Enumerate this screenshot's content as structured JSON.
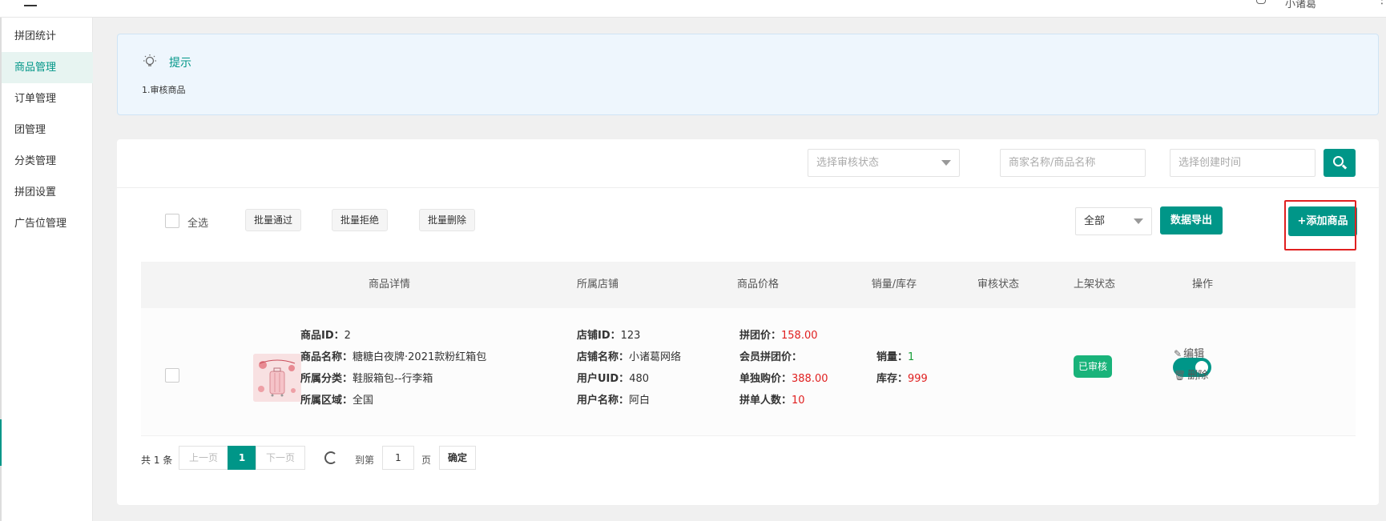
{
  "header": {
    "user_name": "小诸葛"
  },
  "sidebar": {
    "items": [
      {
        "label": "拼团统计"
      },
      {
        "label": "商品管理"
      },
      {
        "label": "订单管理"
      },
      {
        "label": "团管理"
      },
      {
        "label": "分类管理"
      },
      {
        "label": "拼团设置"
      },
      {
        "label": "广告位管理"
      }
    ]
  },
  "tip": {
    "title": "提示",
    "text": "1.审核商品"
  },
  "filters": {
    "status_placeholder": "选择审核状态",
    "keyword_placeholder": "商家名称/商品名称",
    "date_placeholder": "选择创建时间"
  },
  "toolbar": {
    "select_all": "全选",
    "batch_approve": "批量通过",
    "batch_reject": "批量拒绝",
    "batch_delete": "批量删除",
    "scope_value": "全部",
    "export": "数据导出",
    "add": "+添加商品"
  },
  "table": {
    "headers": [
      "商品详情",
      "所属店铺",
      "商品价格",
      "销量/库存",
      "审核状态",
      "上架状态",
      "操作"
    ],
    "row": {
      "product": {
        "id_label": "商品ID：",
        "id": "2",
        "name_label": "商品名称：",
        "name": "糖糖白夜牌·2021款粉红箱包",
        "category_label": "所属分类：",
        "category": "鞋服箱包--行李箱",
        "region_label": "所属区域：",
        "region": "全国"
      },
      "shop": {
        "id_label": "店铺ID：",
        "id": "123",
        "name_label": "店铺名称：",
        "name": "小诸葛网络",
        "uid_label": "用户UID：",
        "uid": "480",
        "user_label": "用户名称：",
        "user": "阿白"
      },
      "price": {
        "group_label": "拼团价：",
        "group": "158.00",
        "member_label": "会员拼团价：",
        "member": "",
        "single_label": "单独购价：",
        "single": "388.00",
        "people_label": "拼单人数：",
        "people": "10"
      },
      "stock": {
        "sales_label": "销量：",
        "sales": "1",
        "stock_label": "库存：",
        "stock": "999"
      },
      "audit_status": "已审核",
      "listed": true,
      "ops": {
        "edit": "编辑",
        "delete": "删除"
      }
    }
  },
  "pager": {
    "total": "共 1 条",
    "prev": "上一页",
    "current": "1",
    "next": "下一页",
    "goto": "到第",
    "page_input": "1",
    "page_unit": "页",
    "confirm": "确定"
  },
  "colors": {
    "accent": "#009688",
    "danger": "#e02020",
    "success": "#1a9e3a",
    "badge": "#19b37a"
  }
}
